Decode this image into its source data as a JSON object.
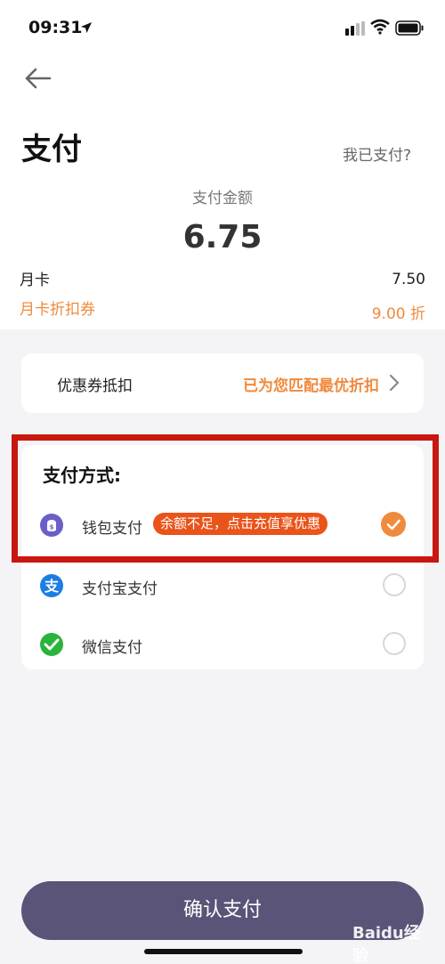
{
  "status_bar": {
    "time": "09:31"
  },
  "header": {
    "title": "支付",
    "paid_link": "我已支付?"
  },
  "amount": {
    "label": "支付金额",
    "value": "6.75"
  },
  "order": {
    "card_name": "月卡",
    "card_price": "7.50",
    "coupon_name": "月卡折扣券",
    "coupon_discount": "9.00 折"
  },
  "coupon_row": {
    "label": "优惠券抵扣",
    "match_text": "已为您匹配最优折扣"
  },
  "payment": {
    "heading": "支付方式:",
    "methods": [
      {
        "name": "钱包支付",
        "badge": "余额不足，点击充值享优惠",
        "selected": true
      },
      {
        "name": "支付宝支付",
        "selected": false
      },
      {
        "name": "微信支付",
        "selected": false
      }
    ]
  },
  "confirm_button": "确认支付",
  "watermark": "Baidu经验",
  "colors": {
    "accent": "#f08a3c",
    "badge": "#e9541a",
    "button": "#5a5478",
    "highlight": "#c8180f"
  }
}
